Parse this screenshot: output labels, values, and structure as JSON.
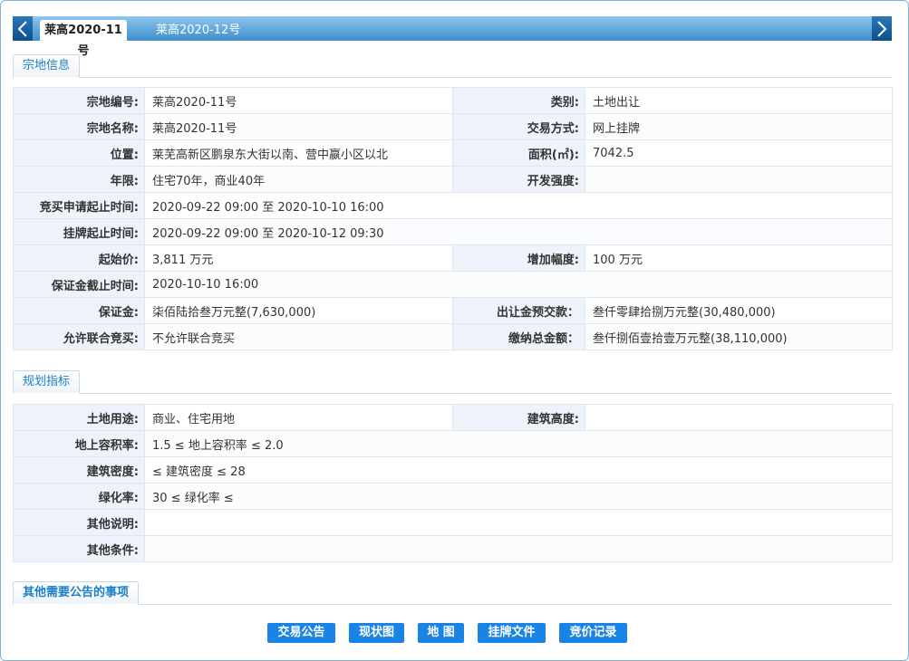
{
  "tabs": {
    "active": "莱高2020-11号",
    "inactive": "莱高2020-12号"
  },
  "sections": {
    "parcel": "宗地信息",
    "planning": "规划指标",
    "other": "其他需要公告的事项"
  },
  "parcel": {
    "r0": {
      "l1": "宗地编号:",
      "v1": "莱高2020-11号",
      "l2": "类别:",
      "v2": "土地出让"
    },
    "r1": {
      "l1": "宗地名称:",
      "v1": "莱高2020-11号",
      "l2": "交易方式:",
      "v2": "网上挂牌"
    },
    "r2": {
      "l1": "位置:",
      "v1": "莱芜高新区鹏泉东大街以南、营中嬴小区以北",
      "l2": "面积(㎡):",
      "v2": "7042.5"
    },
    "r3": {
      "l1": "年限:",
      "v1": "住宅70年，商业40年",
      "l2": "开发强度:",
      "v2": ""
    },
    "r4": {
      "l1": "竞买申请起止时间:",
      "v1": "2020-09-22 09:00 至 2020-10-10 16:00"
    },
    "r5": {
      "l1": "挂牌起止时间:",
      "v1": "2020-09-22 09:00 至 2020-10-12 09:30"
    },
    "r6": {
      "l1": "起始价:",
      "v1": "3,811 万元",
      "l2": "增加幅度:",
      "v2": "100 万元"
    },
    "r7": {
      "l1": "保证金截止时间:",
      "v1": "2020-10-10 16:00"
    },
    "r8": {
      "l1": "保证金:",
      "v1": "柒佰陆拾叁万元整(7,630,000)",
      "l2": "出让金预交款：",
      "v2": "叁仟零肆拾捌万元整(30,480,000)"
    },
    "r9": {
      "l1": "允许联合竞买:",
      "v1": "不允许联合竞买",
      "l2": "缴纳总金额：",
      "v2": "叁仟捌佰壹拾壹万元整(38,110,000)"
    }
  },
  "planning": {
    "r0": {
      "l1": "土地用途:",
      "v1": "商业、住宅用地",
      "l2": "建筑高度:",
      "v2": ""
    },
    "r1": {
      "l1": "地上容积率:",
      "v1": "1.5 ≤ 地上容积率 ≤ 2.0"
    },
    "r2": {
      "l1": "建筑密度:",
      "v1": "≤ 建筑密度 ≤ 28"
    },
    "r3": {
      "l1": "绿化率:",
      "v1": "30 ≤ 绿化率 ≤"
    },
    "r4": {
      "l1": "其他说明:",
      "v1": ""
    },
    "r5": {
      "l1": "其他条件:",
      "v1": ""
    }
  },
  "buttons": {
    "announcement": "交易公告",
    "status_map": "现状图",
    "map": "地 图",
    "listing_doc": "挂牌文件",
    "bid_record": "竞价记录"
  },
  "colors": {
    "accent": "#1a84e6",
    "tabbar": "#3d8fcc",
    "label_bg": "#eef3fb"
  }
}
